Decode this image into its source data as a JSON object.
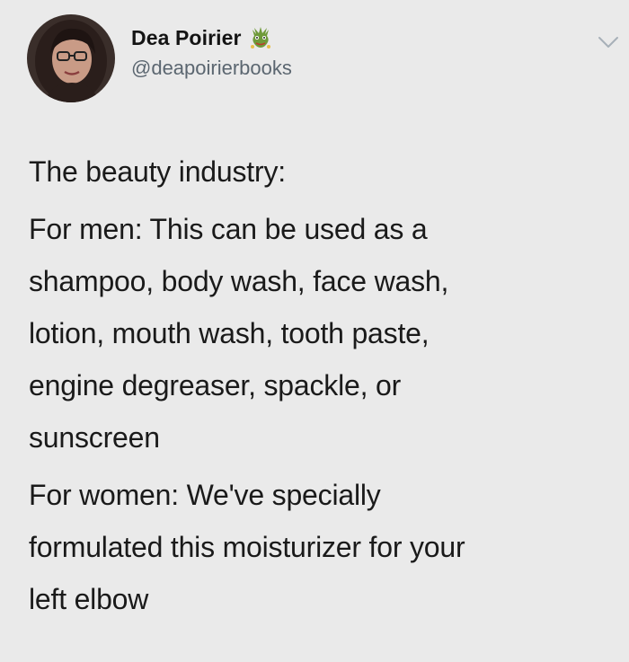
{
  "author": {
    "display_name": "Dea Poirier",
    "handle": "@deapoirierbooks",
    "badge_icon": "dragon-emoji-icon",
    "avatar_icon": "profile-photo"
  },
  "menu": {
    "icon": "chevron-down-icon"
  },
  "tweet": {
    "paragraphs": [
      "The beauty industry:",
      "For men: This can be used as a\nshampoo, body wash, face wash,\nlotion, mouth wash, tooth paste,\nengine degreaser, spackle, or\nsunscreen",
      "For women: We've specially\nformulated this moisturizer for your\nleft elbow"
    ]
  },
  "colors": {
    "background": "#eaeaea",
    "text": "#1a1a1a",
    "handle": "#5b6670",
    "chevron": "#a7b0b8"
  }
}
